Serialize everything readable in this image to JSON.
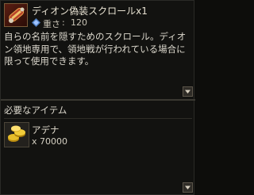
{
  "item": {
    "name": "ディオン偽装スクロール",
    "quantity_suffix": "x1",
    "weight_label": "重さ",
    "weight_separator": ":",
    "weight_value": "120",
    "description": "自らの名前を隠すためのスクロール。ディオン領地専用で、領地戦が行われている場合に限って使用できます。",
    "icon": "scroll-icon",
    "weight_icon": "weight-crystal-icon"
  },
  "required_section": {
    "title": "必要なアイテム",
    "items": [
      {
        "name": "アデナ",
        "count_prefix": "x",
        "count": "70000",
        "icon": "adena-coins-icon"
      }
    ]
  },
  "colors": {
    "background": "#121210",
    "text": "#dcd8cd",
    "accent_border": "#7a5b38"
  }
}
